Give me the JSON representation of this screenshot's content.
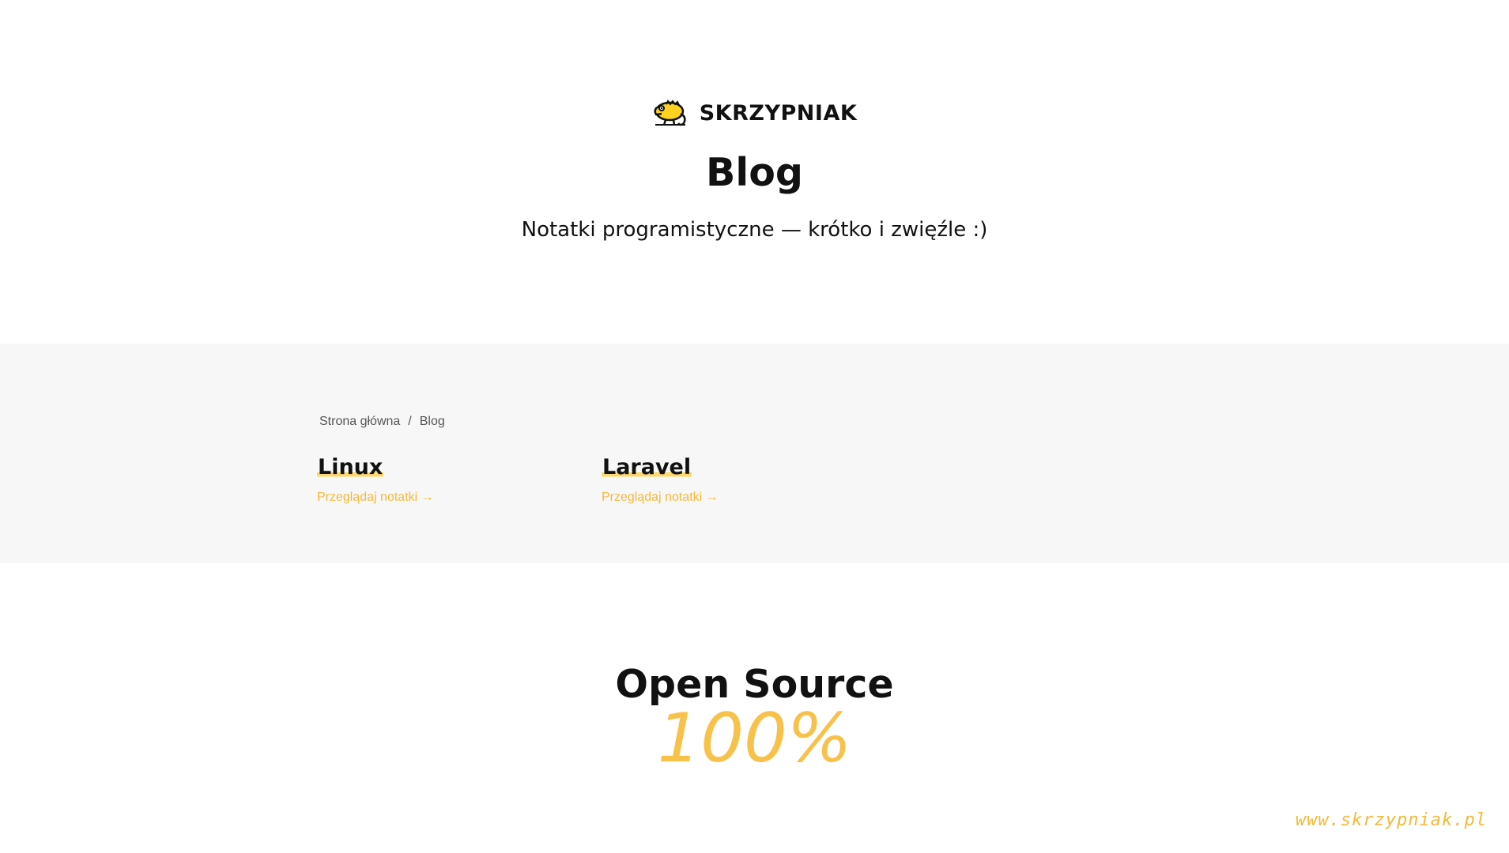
{
  "header": {
    "brand_name": "SKRZYPNIAK",
    "logo_icon": "chameleon-icon",
    "title": "Blog",
    "subtitle": "Notatki programistyczne — krótko i zwięźle :)"
  },
  "breadcrumb": {
    "items": [
      "Strona główna",
      "Blog"
    ],
    "separator": "/"
  },
  "categories": [
    {
      "title": "Linux",
      "link": "Przeglądaj notatki →"
    },
    {
      "title": "Laravel",
      "link": "Przeglądaj notatki →"
    }
  ],
  "open_source": {
    "title": "Open Source",
    "value": "100%"
  },
  "watermark": "www.skrzypniak.pl",
  "colors": {
    "accent": "#f8c14a",
    "section_bg": "#f7f7f7",
    "text": "#111111"
  }
}
